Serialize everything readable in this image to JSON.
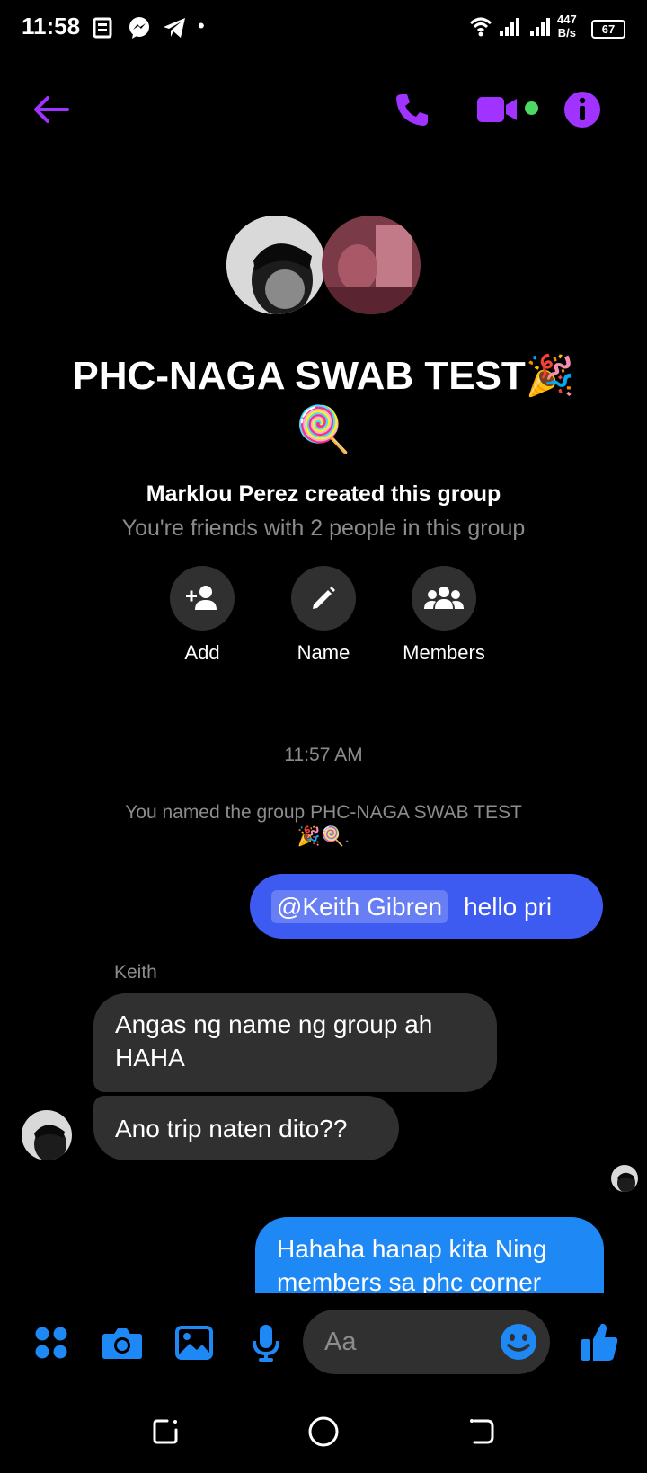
{
  "status_bar": {
    "time": "11:58",
    "net_speed_value": "447",
    "net_speed_unit": "B/s",
    "battery": "67",
    "dot": "•"
  },
  "header": {
    "back_icon": "arrow-left-icon",
    "call_icon": "phone-icon",
    "video_icon": "video-camera-icon",
    "info_icon": "info-icon",
    "accent_color": "#a033ff",
    "online_color": "#4cd964"
  },
  "group": {
    "title": "PHC-NAGA SWAB TEST🎉",
    "title_emoji_line": "🍭",
    "created_by": "Marklou Perez created this group",
    "friends_info": "You're friends with 2 people in this group"
  },
  "actions": [
    {
      "label": "Add",
      "icon": "add-person-icon"
    },
    {
      "label": "Name",
      "icon": "pencil-icon"
    },
    {
      "label": "Members",
      "icon": "group-icon"
    }
  ],
  "conversation": {
    "timestamp": "11:57 AM",
    "system_message_line1": "You named the group PHC-NAGA SWAB TEST",
    "system_message_line2": "🎉🍭.",
    "messages": [
      {
        "sender": "me",
        "mention": "@Keith Gibren",
        "text": "hello pri"
      },
      {
        "sender_name": "Keith",
        "text_line1": "Angas ng name ng group ah",
        "text_line2": "HAHA"
      },
      {
        "sender": "Keith",
        "text": "Ano trip naten dito??"
      },
      {
        "sender": "me",
        "text_line1": "Hahaha hanap kita Ning",
        "text_line2": "members sa phc corner"
      }
    ]
  },
  "composer": {
    "placeholder": "Aa",
    "menu_icon": "apps-grid-icon",
    "camera_icon": "camera-icon",
    "gallery_icon": "image-icon",
    "mic_icon": "microphone-icon",
    "emoji_icon": "smiley-icon",
    "like_icon": "thumbs-up-icon",
    "accent_color": "#1e88f5"
  },
  "nav_bar": {
    "back_icon": "nav-back-icon",
    "home_icon": "nav-home-icon",
    "recents_icon": "nav-recents-icon"
  }
}
